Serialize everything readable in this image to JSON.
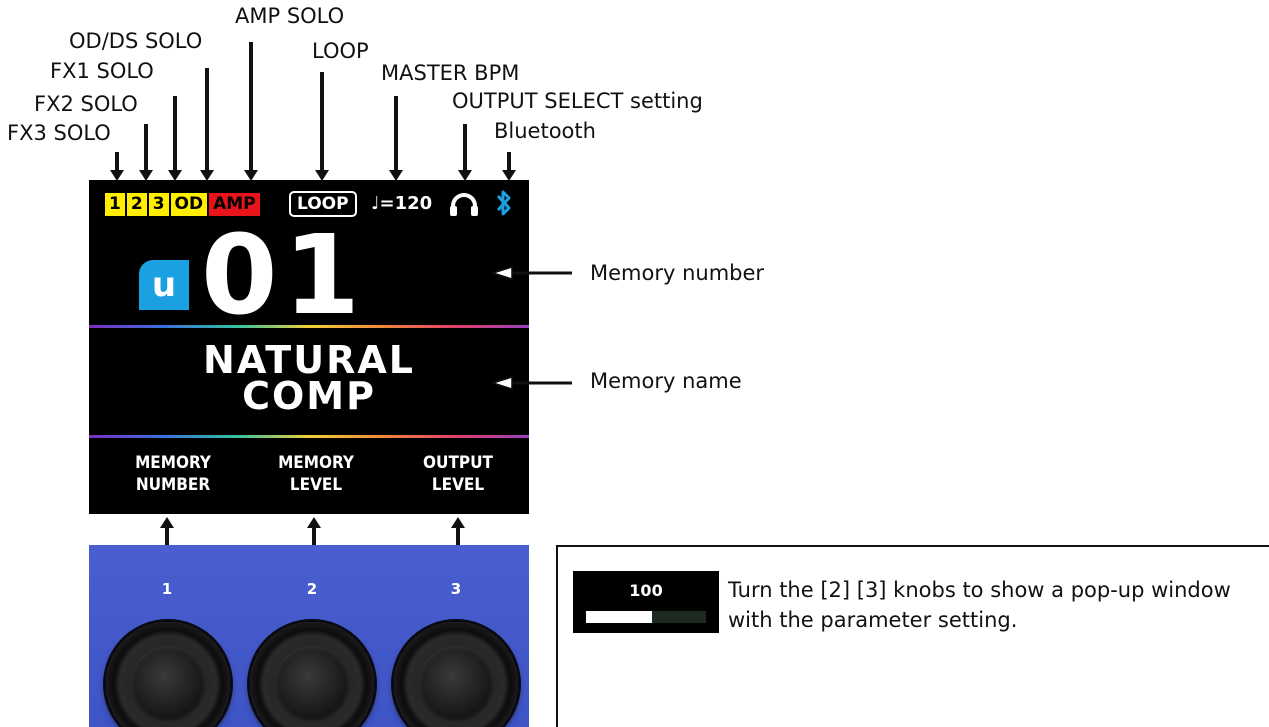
{
  "labels": {
    "fx3_solo": "FX3 SOLO",
    "fx2_solo": "FX2 SOLO",
    "fx1_solo": "FX1 SOLO",
    "odds_solo": "OD/DS SOLO",
    "amp_solo": "AMP SOLO",
    "loop": "LOOP",
    "master_bpm": "MASTER BPM",
    "output_select": "OUTPUT SELECT setting",
    "bluetooth": "Bluetooth",
    "memory_number": "Memory number",
    "memory_name": "Memory name"
  },
  "display": {
    "solo_badges": [
      "1",
      "2",
      "3",
      "OD",
      "AMP"
    ],
    "loop_badge": "LOOP",
    "bpm": "♩=120",
    "user_badge": "u",
    "memory_number": "01",
    "memory_name_line1": "NATURAL",
    "memory_name_line2": "COMP",
    "knob_labels": [
      "MEMORY\nNUMBER",
      "MEMORY\nLEVEL",
      "OUTPUT\nLEVEL"
    ],
    "colors": {
      "solo_badge": "#ffee00",
      "amp_badge": "#e8131b",
      "user_badge": "#1ba0e1",
      "bluetooth": "#1ba0e1"
    }
  },
  "knobs": {
    "numbers": [
      "1",
      "2",
      "3"
    ]
  },
  "note": {
    "popup_value": "100",
    "popup_level_fraction": 0.55,
    "text": "Turn the [2] [3] knobs to show a pop-up window with the parameter setting."
  }
}
